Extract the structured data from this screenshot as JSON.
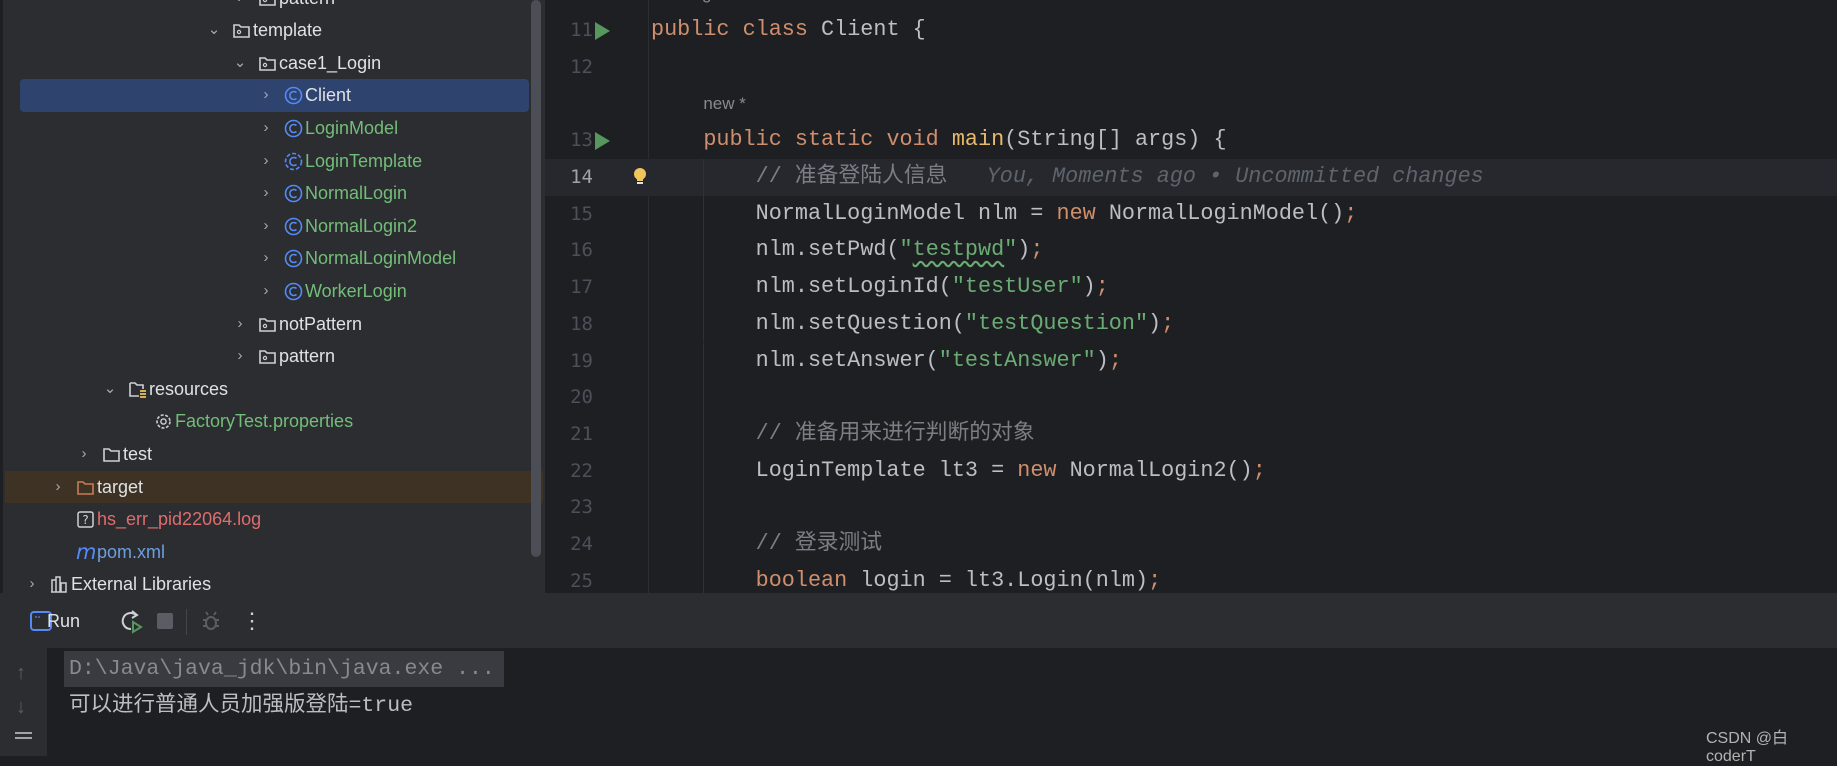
{
  "project_tree": {
    "items": [
      {
        "label": "pattern",
        "level": 8,
        "chevron": "right",
        "icon": "package-folder-icon",
        "color": "#dfe1e5"
      },
      {
        "label": "template",
        "level": 7,
        "chevron": "down",
        "icon": "package-folder-icon",
        "color": "#dfe1e5"
      },
      {
        "label": "case1_Login",
        "level": 8,
        "chevron": "down",
        "icon": "package-folder-icon",
        "color": "#dfe1e5"
      },
      {
        "label": "Client",
        "level": 9,
        "chevron": "right",
        "icon": "class-icon",
        "color": "#dfe1e5",
        "selected": true
      },
      {
        "label": "LoginModel",
        "level": 9,
        "chevron": "right",
        "icon": "class-icon",
        "color": "#73bd79"
      },
      {
        "label": "LoginTemplate",
        "level": 9,
        "chevron": "right",
        "icon": "abstract-class-icon",
        "color": "#73bd79"
      },
      {
        "label": "NormalLogin",
        "level": 9,
        "chevron": "right",
        "icon": "class-icon",
        "color": "#73bd79"
      },
      {
        "label": "NormalLogin2",
        "level": 9,
        "chevron": "right",
        "icon": "class-icon",
        "color": "#73bd79"
      },
      {
        "label": "NormalLoginModel",
        "level": 9,
        "chevron": "right",
        "icon": "class-icon",
        "color": "#73bd79"
      },
      {
        "label": "WorkerLogin",
        "level": 9,
        "chevron": "right",
        "icon": "class-icon",
        "color": "#73bd79"
      },
      {
        "label": "notPattern",
        "level": 8,
        "chevron": "right",
        "icon": "package-folder-icon",
        "color": "#dfe1e5"
      },
      {
        "label": "pattern",
        "level": 8,
        "chevron": "right",
        "icon": "package-folder-icon",
        "color": "#dfe1e5"
      },
      {
        "label": "resources",
        "level": 3,
        "chevron": "down",
        "icon": "resources-folder-icon",
        "color": "#dfe1e5"
      },
      {
        "label": "FactoryTest.properties",
        "level": 4,
        "chevron": "none",
        "icon": "gear-icon",
        "color": "#73bd79"
      },
      {
        "label": "test",
        "level": 2,
        "chevron": "right",
        "icon": "folder-icon",
        "color": "#dfe1e5"
      },
      {
        "label": "target",
        "level": 1,
        "chevron": "right",
        "icon": "excluded-folder-icon",
        "color": "#dfe1e5",
        "excluded": true
      },
      {
        "label": "hs_err_pid22064.log",
        "level": 1,
        "chevron": "none",
        "icon": "unknown-file-icon",
        "color": "#e06c6c"
      },
      {
        "label": "pom.xml",
        "level": 1,
        "chevron": "none",
        "icon": "maven-icon",
        "color": "#6c9fe0"
      },
      {
        "label": "External Libraries",
        "level": 0,
        "chevron": "right",
        "icon": "libraries-icon",
        "color": "#dfe1e5"
      }
    ]
  },
  "editor": {
    "top_hint": "no usages   new *",
    "method_hint": "new *",
    "current_line": 14,
    "blame": "You, Moments ago • Uncommitted changes",
    "lines": [
      {
        "n": "11",
        "indent": 0,
        "run": true,
        "tokens": [
          [
            "kw",
            "public "
          ],
          [
            "kw",
            "class "
          ],
          [
            "",
            "Client {"
          ]
        ]
      },
      {
        "n": "12",
        "indent": 0,
        "tokens": []
      },
      {
        "n": "13",
        "indent": 1,
        "run": true,
        "hint_before": true,
        "tokens": [
          [
            "kw",
            "public "
          ],
          [
            "kw",
            "static "
          ],
          [
            "kw",
            "void "
          ],
          [
            "fn",
            "main"
          ],
          [
            "",
            "(String[] args) {"
          ]
        ]
      },
      {
        "n": "14",
        "indent": 2,
        "bulb": true,
        "tokens": [
          [
            "cm",
            "// 准备登陆人信息"
          ]
        ]
      },
      {
        "n": "15",
        "indent": 2,
        "tokens": [
          [
            "",
            "NormalLoginModel nlm = "
          ],
          [
            "kw",
            "new "
          ],
          [
            "",
            "NormalLoginModel()"
          ],
          [
            "sc",
            ";"
          ]
        ]
      },
      {
        "n": "16",
        "indent": 2,
        "tokens": [
          [
            "",
            "nlm.setPwd("
          ],
          [
            "str",
            "\""
          ],
          [
            "str wavy",
            "testpwd"
          ],
          [
            "str",
            "\""
          ],
          [
            "",
            ")"
          ],
          [
            "sc",
            ";"
          ]
        ]
      },
      {
        "n": "17",
        "indent": 2,
        "tokens": [
          [
            "",
            "nlm.setLoginId("
          ],
          [
            "str",
            "\"testUser\""
          ],
          [
            "",
            ")"
          ],
          [
            "sc",
            ";"
          ]
        ]
      },
      {
        "n": "18",
        "indent": 2,
        "tokens": [
          [
            "",
            "nlm.setQuestion("
          ],
          [
            "str",
            "\"testQuestion\""
          ],
          [
            "",
            ")"
          ],
          [
            "sc",
            ";"
          ]
        ]
      },
      {
        "n": "19",
        "indent": 2,
        "tokens": [
          [
            "",
            "nlm.setAnswer("
          ],
          [
            "str",
            "\"testAnswer\""
          ],
          [
            "",
            ")"
          ],
          [
            "sc",
            ";"
          ]
        ]
      },
      {
        "n": "20",
        "indent": 2,
        "tokens": []
      },
      {
        "n": "21",
        "indent": 2,
        "tokens": [
          [
            "cm",
            "// 准备用来进行判断的对象"
          ]
        ]
      },
      {
        "n": "22",
        "indent": 2,
        "tokens": [
          [
            "",
            "LoginTemplate lt3 = "
          ],
          [
            "kw",
            "new "
          ],
          [
            "",
            "NormalLogin2()"
          ],
          [
            "sc",
            ";"
          ]
        ]
      },
      {
        "n": "23",
        "indent": 2,
        "tokens": []
      },
      {
        "n": "24",
        "indent": 2,
        "tokens": [
          [
            "cm",
            "// 登录测试"
          ]
        ]
      },
      {
        "n": "25",
        "indent": 2,
        "tokens": [
          [
            "kw",
            "boolean "
          ],
          [
            "",
            "login = lt3.Login(nlm)"
          ],
          [
            "sc",
            ";"
          ]
        ]
      }
    ]
  },
  "run_panel": {
    "title": "Run",
    "console": [
      "D:\\Java\\java_jdk\\bin\\java.exe ...",
      "可以进行普通人员加强版登陆=true"
    ]
  },
  "watermark": "CSDN @白coderT",
  "colors": {
    "accent": "#2e436e",
    "keyword": "#cf8e6d",
    "string": "#6aab73",
    "run_green": "#57965c"
  }
}
